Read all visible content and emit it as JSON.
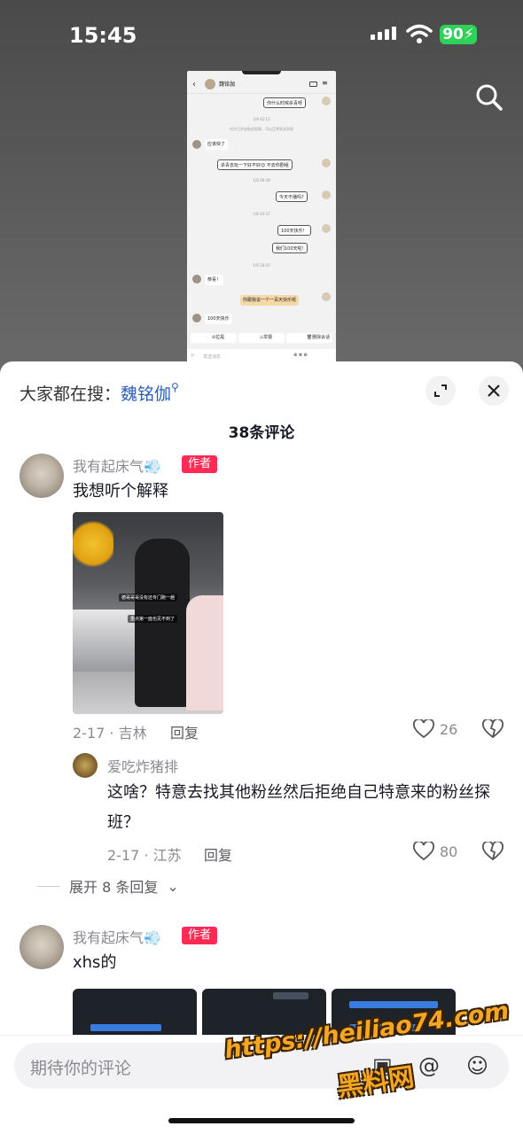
{
  "status_bar": {
    "time": "15:45",
    "battery": "90"
  },
  "embedded_chat": {
    "contact_name": "魏铭伽",
    "messages": [
      {
        "side": "me",
        "text": "你什么时候杀青呀"
      },
      {
        "side": "time",
        "text": "1/8 02:12"
      },
      {
        "side": "time",
        "text": "对方已开启私信权限，可以正常发送消息"
      },
      {
        "side": "them",
        "text": "应该快了"
      },
      {
        "side": "me",
        "text": "杀青去玩一下好不好😊 不去你剧组"
      },
      {
        "side": "time",
        "text": "1/8 06:38"
      },
      {
        "side": "me",
        "text": "今天不播吗?"
      },
      {
        "side": "time",
        "text": "1/8 20:37"
      },
      {
        "side": "me",
        "text": "100天快乐！"
      },
      {
        "side": "me",
        "text": "我们100天啦!"
      },
      {
        "side": "time",
        "text": "1/9 18:20"
      },
      {
        "side": "them",
        "text": "恭喜！"
      },
      {
        "side": "me_orange",
        "text": "你跟我说一个一百天快乐呢"
      },
      {
        "side": "them",
        "text": "100天快乐"
      }
    ],
    "tools": [
      "拉黑",
      "举报",
      "删除会话"
    ],
    "input_placeholder": "发送消息"
  },
  "sheet": {
    "hot_search_prefix": "大家都在搜：",
    "hot_search_term": "魏铭伽",
    "comment_count": "38条评论",
    "comments": [
      {
        "user": "我有起床气💨",
        "badge": "作者",
        "text": "我想听个解释",
        "photo_captions": [
          "德哥哥哥没有还专门跑一趟",
          "重点第一面也见不到了"
        ],
        "meta": "2-17 · 吉林",
        "reply_label": "回复",
        "likes": "26",
        "replies": [
          {
            "user": "爱吃炸猪排",
            "text": "这啥？特意去找其他粉丝然后拒绝自己特意来的粉丝探班？",
            "meta": "2-17 · 江苏",
            "reply_label": "回复",
            "likes": "80"
          }
        ],
        "expand_label": "展开 8 条回复"
      },
      {
        "user": "我有起床气💨",
        "badge": "作者",
        "text": "xhs的",
        "meta": "",
        "likes": ""
      }
    ],
    "input_placeholder": "期待你的评论"
  },
  "watermark": {
    "url": "https://heiliao74.com",
    "name": "黑料网"
  },
  "colors": {
    "accent": "#fe2c55",
    "link": "#2a5fb8",
    "battery": "#30d158",
    "watermark": "#f5a623"
  }
}
